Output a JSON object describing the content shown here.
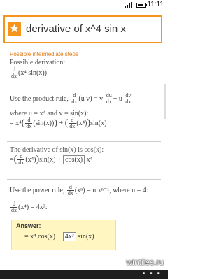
{
  "status": {
    "time": "11:11"
  },
  "search": {
    "query": "derivative of x^4 sin x"
  },
  "steps": {
    "heading": "Possible intermediate steps",
    "sub": "Possible derivation:",
    "d": "d",
    "dx": "dx",
    "expr1": "(x⁴ sin(x))",
    "product_rule_pre": "Use the product rule,",
    "product_rule_uv": "(u v) = v",
    "product_rule_du": "du",
    "product_rule_mid": "+ u",
    "product_rule_dv": "dv",
    "where_line": "where u = x⁴ and v = sin(x):",
    "eq1_a": "= x⁴",
    "eq1_b": "(sin(x))",
    "eq1_c": "+",
    "eq1_d": "(x⁴)",
    "eq1_e": "sin(x)",
    "deriv_sin_text": "The derivative of sin(x) is cos(x):",
    "eq2_a": "=",
    "eq2_b": "(x⁴)",
    "eq2_c": "sin(x) +",
    "eq2_box": "cos(x)",
    "eq2_d": "x⁴",
    "power_rule_pre": "Use the power rule,",
    "power_rule_mid": "(xⁿ) = n xⁿ⁻¹, where n = 4:",
    "eq3": "(x⁴) = 4x³:",
    "answer_label": "Answer:",
    "answer_a": "= x⁴ cos(x) +",
    "answer_box": "4x³",
    "answer_b": "sin(x)"
  },
  "watermark": "wintiles.ru",
  "colors": {
    "accent": "#f7941d",
    "heading": "#e07a18",
    "answer_bg": "#fff6c2"
  },
  "icons": {
    "logo": "wolfram-alpha-logo",
    "more": "more-dots-icon"
  }
}
